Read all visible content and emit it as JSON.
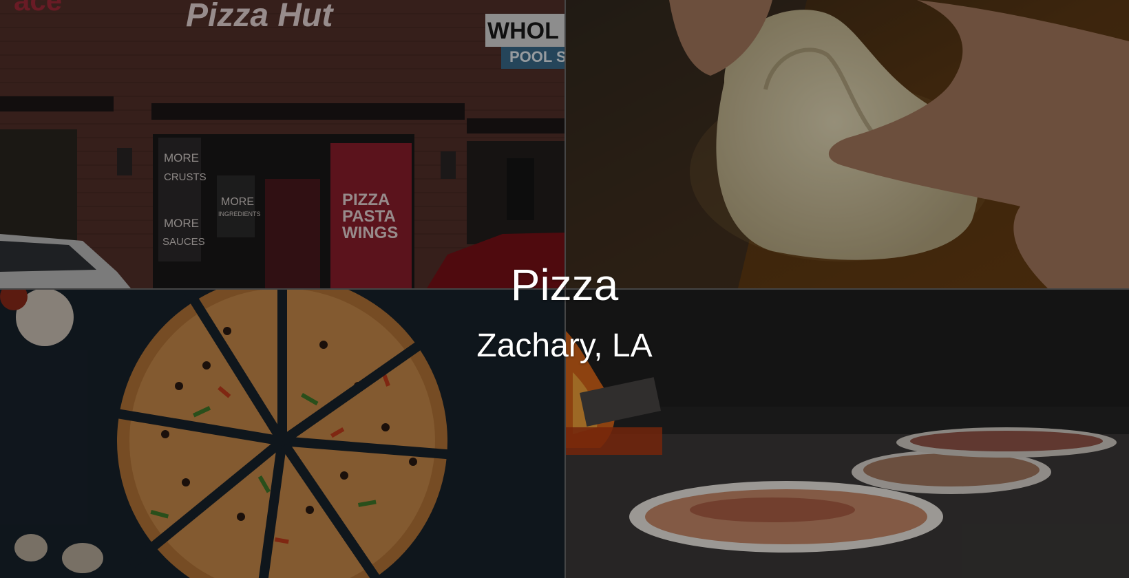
{
  "hero": {
    "title": "Pizza",
    "subtitle": "Zachary, LA"
  },
  "photos": {
    "storefront": {
      "brand_sign": "Pizza Hut",
      "neighbor_sign_top": "WHOL",
      "neighbor_sign_bottom": "POOL S",
      "left_sign": "ace",
      "poster_1_lines": [
        "MORE",
        "CRUSTS",
        "MORE",
        "SAUCES"
      ],
      "poster_2_lines": [
        "MORE",
        "INGREDIENTS"
      ],
      "poster_3_lines": [
        "PIZZA",
        "PASTA",
        "WINGS"
      ]
    }
  },
  "colors": {
    "brick": "#5a3128",
    "red": "#8a1a25",
    "wood": "#5a3712",
    "dough": "#d9cfae",
    "board": "#1b2530",
    "oven": "#2b2b2b"
  }
}
